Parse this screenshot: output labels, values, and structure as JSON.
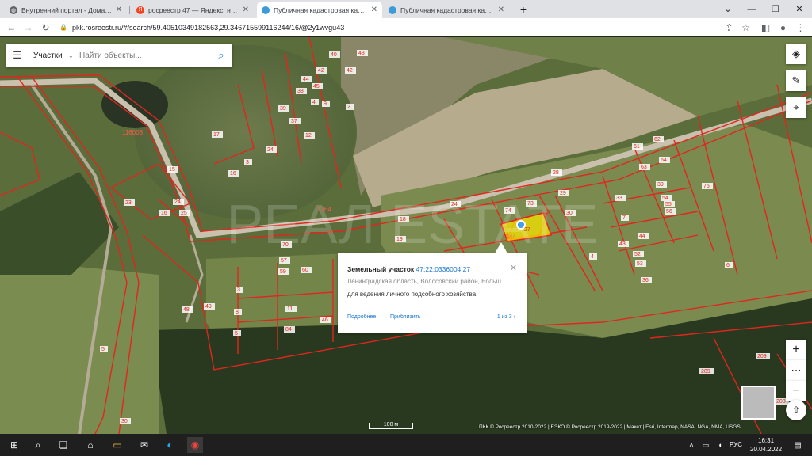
{
  "tabs": [
    {
      "title": "Внутренний портал - Домашня",
      "icon": "globe-icon",
      "active": false
    },
    {
      "title": "росреестр 47 — Яндекс: нашло",
      "icon": "yandex-icon",
      "active": false
    },
    {
      "title": "Публичная кадастровая карта",
      "icon": "pkk-icon",
      "active": true
    },
    {
      "title": "Публичная кадастровая карта",
      "icon": "pkk-icon",
      "active": false
    }
  ],
  "address_bar": {
    "url": "pkk.rosreestr.ru/#/search/59.40510349182563,29.346715599116244/16/@2y1wvgu43"
  },
  "search": {
    "category": "Участки",
    "placeholder": "Найти объекты..."
  },
  "map": {
    "plot_labels": [
      {
        "text": "62"
      },
      {
        "text": "61"
      },
      {
        "text": "63"
      },
      {
        "text": "64"
      },
      {
        "text": "75"
      },
      {
        "text": "39"
      },
      {
        "text": "33"
      },
      {
        "text": "54"
      },
      {
        "text": "55"
      },
      {
        "text": "56"
      },
      {
        "text": "7"
      },
      {
        "text": "44"
      },
      {
        "text": "43"
      },
      {
        "text": "52"
      },
      {
        "text": "53"
      },
      {
        "text": "36"
      },
      {
        "text": "28"
      },
      {
        "text": "29"
      },
      {
        "text": "30"
      },
      {
        "text": "73"
      },
      {
        "text": "74"
      },
      {
        "text": "24"
      },
      {
        "text": "18"
      },
      {
        "text": "19"
      },
      {
        "text": "4"
      },
      {
        "text": "6"
      },
      {
        "text": "70"
      },
      {
        "text": "57"
      },
      {
        "text": "60"
      },
      {
        "text": "59"
      },
      {
        "text": "3"
      },
      {
        "text": "8"
      },
      {
        "text": "5"
      },
      {
        "text": "11"
      },
      {
        "text": "84"
      },
      {
        "text": "46"
      },
      {
        "text": "48"
      },
      {
        "text": "49"
      },
      {
        "text": "209"
      },
      {
        "text": "209"
      },
      {
        "text": "208"
      },
      {
        "text": "30"
      },
      {
        "text": "5"
      },
      {
        "text": "24"
      },
      {
        "text": "17"
      },
      {
        "text": "3"
      },
      {
        "text": "16"
      },
      {
        "text": "23"
      },
      {
        "text": "24"
      },
      {
        "text": "25"
      },
      {
        "text": "16"
      },
      {
        "text": "15"
      },
      {
        "text": "44"
      },
      {
        "text": "45"
      },
      {
        "text": "42"
      },
      {
        "text": "40"
      },
      {
        "text": "42"
      },
      {
        "text": "43"
      },
      {
        "text": "38"
      },
      {
        "text": "39"
      },
      {
        "text": "37"
      },
      {
        "text": "12"
      },
      {
        "text": "9"
      },
      {
        "text": "4"
      },
      {
        "text": "2"
      }
    ],
    "quarter_labels": [
      {
        "text": "116003"
      },
      {
        "text": "1264"
      },
      {
        "text": "1344"
      }
    ],
    "selected_plot_label": "27",
    "watermark": "РЕАЛ ESTATE"
  },
  "popup": {
    "type": "Земельный участок",
    "cadastral_number": "47:22:0336004:27",
    "address": "Ленинградская область, Волосовский район, Больш...",
    "use": "для ведения личного подсобного хозяйства",
    "details_link": "Подробнее",
    "zoom_link": "Приблизить",
    "pager": "1 из 3"
  },
  "scale": {
    "label": "100 м"
  },
  "attribution": "ПКК © Росреестр 2010-2022 | ЕЭКО © Росреестр 2019-2022 | Макет | Esri, Intermap, NASA, NGA, NMA, USGS",
  "taskbar": {
    "time": "16:31",
    "date": "20.04.2022",
    "lang": "РУС"
  },
  "colors": {
    "boundary": "#e0261f",
    "selected_fill": "#f5e400",
    "link": "#1976d2"
  }
}
